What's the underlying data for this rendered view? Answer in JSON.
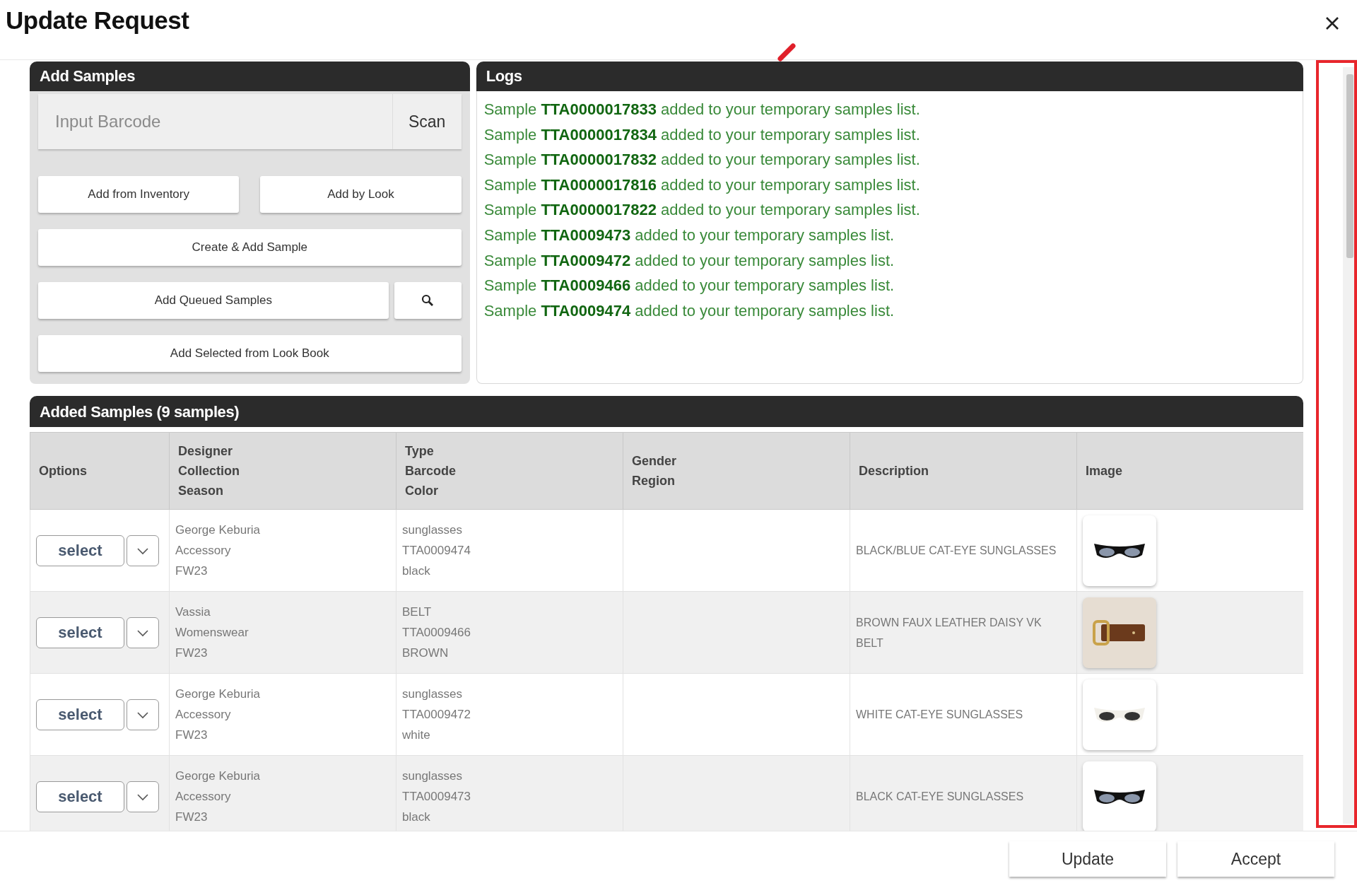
{
  "dialog": {
    "title": "Update Request"
  },
  "add_samples": {
    "title": "Add Samples",
    "barcode": {
      "placeholder": "Input Barcode"
    },
    "scan_button": "Scan",
    "add_from_inventory": "Add from Inventory",
    "add_by_look": "Add by Look",
    "create_and_add": "Create & Add Sample",
    "add_queued": "Add Queued Samples",
    "add_from_look_book": "Add Selected from Look Book"
  },
  "logs": {
    "title": "Logs",
    "entries": [
      "Sample **TTA0000017833** added to your temporary samples list.",
      "Sample **TTA0000017834** added to your temporary samples list.",
      "Sample **TTA0000017832** added to your temporary samples list.",
      "Sample **TTA0000017816** added to your temporary samples list.",
      "Sample **TTA0000017822** added to your temporary samples list.",
      "Sample **TTA0009473** added to your temporary samples list.",
      "Sample **TTA0009472** added to your temporary samples list.",
      "Sample **TTA0009466** added to your temporary samples list.",
      "Sample **TTA0009474** added to your temporary samples list."
    ]
  },
  "added_samples": {
    "title": "Added Samples (9 samples)",
    "columns": [
      "Options",
      "Designer\nCollection\nSeason",
      "Type\nBarcode\nColor",
      "Gender\nRegion",
      "Description",
      "Image"
    ],
    "rows": [
      {
        "option": "select",
        "designer": "George Keburia\nAccessory\nFW23",
        "type": "sunglasses\nTTA0009474\nblack",
        "description": "BLACK/BLUE CAT-EYE SUNGLASSES",
        "image": {
          "kind": "sunglasses",
          "color": "#111111"
        }
      },
      {
        "option": "select",
        "designer": "Vassia\nWomenswear\nFW23",
        "type": "BELT\nTTA0009466\nBROWN",
        "description": "BROWN FAUX LEATHER DAISY VK BELT",
        "image": {
          "kind": "belt"
        }
      },
      {
        "option": "select",
        "designer": "George Keburia\nAccessory\nFW23",
        "type": "sunglasses\nTTA0009472\nwhite",
        "description": "WHITE CAT-EYE SUNGLASSES",
        "image": {
          "kind": "sunglasses",
          "color": "#f2f0ea"
        }
      },
      {
        "option": "select",
        "designer": "George Keburia\nAccessory\nFW23",
        "type": "sunglasses\nTTA0009473\nblack",
        "description": "BLACK CAT-EYE SUNGLASSES",
        "image": {
          "kind": "sunglasses",
          "color": "#111111"
        }
      }
    ]
  },
  "footer": {
    "buttons": [
      "Update",
      "Accept"
    ]
  }
}
